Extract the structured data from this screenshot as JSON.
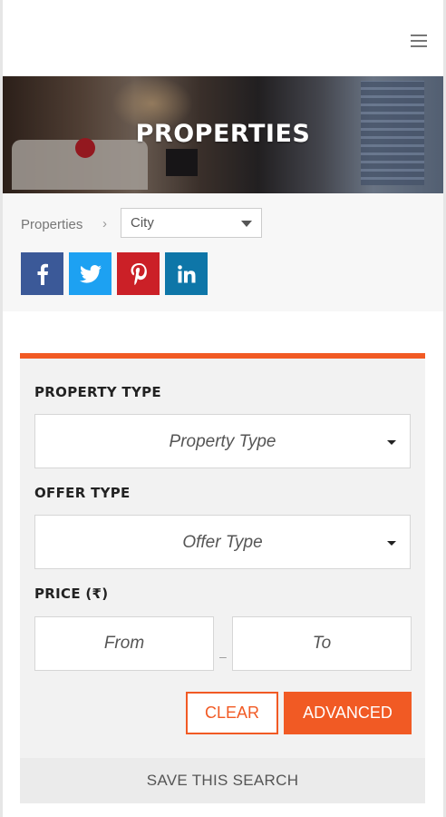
{
  "header": {
    "menu_icon": "hamburger-menu-icon"
  },
  "hero": {
    "title": "PROPERTIES"
  },
  "breadcrumb": {
    "home_label": "Properties",
    "separator": "›",
    "city_select": {
      "selected": "City"
    }
  },
  "social": {
    "items": [
      {
        "icon": "facebook-icon",
        "color": "#3b5998"
      },
      {
        "icon": "twitter-icon",
        "color": "#1da1f2"
      },
      {
        "icon": "pinterest-icon",
        "color": "#cb2027"
      },
      {
        "icon": "linkedin-icon",
        "color": "#0e76a8"
      }
    ]
  },
  "search_form": {
    "accent_color": "#f15a24",
    "property_type": {
      "label": "PROPERTY TYPE",
      "selected": "Property Type"
    },
    "offer_type": {
      "label": "OFFER TYPE",
      "selected": "Offer Type"
    },
    "price": {
      "label": "PRICE (₹)",
      "from_placeholder": "From",
      "to_placeholder": "To",
      "separator": "–"
    },
    "clear_label": "CLEAR",
    "advanced_label": "ADVANCED",
    "save_search_label": "SAVE THIS SEARCH"
  }
}
